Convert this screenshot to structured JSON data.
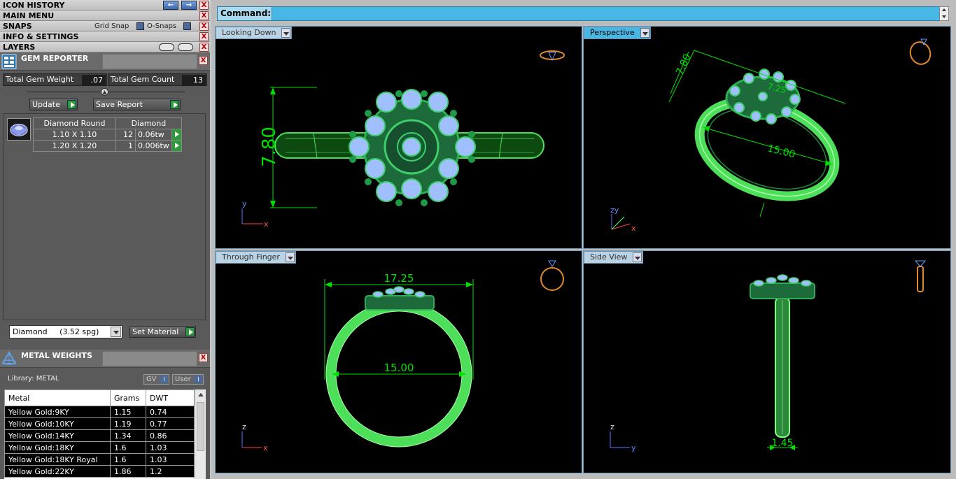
{
  "menus": {
    "icon_history": "ICON HISTORY",
    "main_menu": "MAIN MENU",
    "snaps": "SNAPS",
    "grid_snap": "Grid Snap",
    "o_snaps": "O-Snaps",
    "info_settings": "INFO & SETTINGS",
    "layers": "LAYERS",
    "close_glyph": "X"
  },
  "gem_reporter": {
    "title": "GEM REPORTER",
    "total_weight_label": "Total Gem Weight",
    "total_weight_value": ".07",
    "total_count_label": "Total Gem Count",
    "total_count_value": "13",
    "update_label": "Update",
    "save_report_label": "Save Report",
    "col1_header": "Diamond Round",
    "col2_header": "Diamond",
    "rows": [
      {
        "size": "1.10 X 1.10",
        "count": "12",
        "weight": "0.06tw"
      },
      {
        "size": "1.20 X 1.20",
        "count": "1",
        "weight": "0.006tw"
      }
    ],
    "material_value": "Diamond     (3.52 spg)",
    "set_material_label": "Set Material"
  },
  "metal_weights": {
    "title": "METAL WEIGHTS",
    "library": "Library: METAL",
    "gv_label": "GV",
    "user_label": "User",
    "toggle_glyph": "I",
    "headers": [
      "Metal",
      "Grams",
      "DWT"
    ],
    "rows": [
      [
        "Yellow Gold:9KY",
        "1.15",
        "0.74"
      ],
      [
        "Yellow Gold:10KY",
        "1.19",
        "0.77"
      ],
      [
        "Yellow Gold:14KY",
        "1.34",
        "0.86"
      ],
      [
        "Yellow Gold:18KY",
        "1.6",
        "1.03"
      ],
      [
        "Yellow Gold:18KY Royal",
        "1.6",
        "1.03"
      ],
      [
        "Yellow Gold:22KY",
        "1.86",
        "1.2"
      ]
    ]
  },
  "command": {
    "label": "Command:"
  },
  "viewports": {
    "top_left": {
      "name": "Looking Down",
      "dimension": "7.80",
      "axis_v": "y",
      "axis_h": "x"
    },
    "top_right": {
      "name": "Perspective",
      "dimension_a": "7.80",
      "dimension_b": "15.00",
      "dimension_c": "7.25",
      "axis_v": "zy",
      "axis_h": "x"
    },
    "bottom_left": {
      "name": "Through Finger",
      "dimension_a": "17.25",
      "dimension_b": "15.00",
      "axis_v": "z",
      "axis_h": "x"
    },
    "bottom_right": {
      "name": "Side View",
      "dimension": "1.45",
      "axis_v": "z",
      "axis_h": "y"
    }
  },
  "colors": {
    "model_green": "#4ddf5a",
    "gem_blue": "#8fb4ff",
    "dim_green": "#00e000",
    "tab_active": "#48b7e3",
    "cube_orange": "#e08a2a"
  }
}
